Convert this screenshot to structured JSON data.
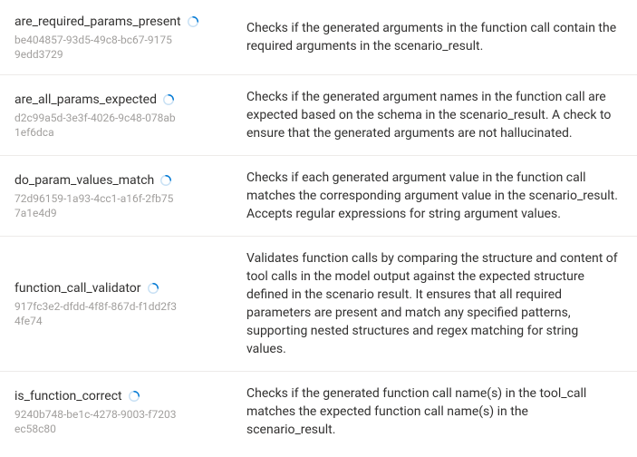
{
  "items": [
    {
      "name": "are_required_params_present",
      "uuid": "be404857-93d5-49c8-bc67-91759edd3729",
      "description": "Checks if the generated arguments in the function call contain the required arguments in the scenario_result."
    },
    {
      "name": "are_all_params_expected",
      "uuid": "d2c99a5d-3e3f-4026-9c48-078ab1ef6dca",
      "description": "Checks if the generated argument names in the function call are expected based on the schema in the scenario_result. A check to ensure that the generated arguments are not hallucinated."
    },
    {
      "name": "do_param_values_match",
      "uuid": "72d96159-1a93-4cc1-a16f-2fb757a1e4d9",
      "description": "Checks if each generated argument value in the function call matches the corresponding argument value in the scenario_result. Accepts regular expressions for string argument values."
    },
    {
      "name": "function_call_validator",
      "uuid": "917fc3e2-dfdd-4f8f-867d-f1dd2f34fe74",
      "description": "Validates function calls by comparing the structure and content of tool calls in the model output against the expected structure defined in the scenario result. It ensures that all required parameters are present and match any specified patterns, supporting nested structures and regex matching for string values."
    },
    {
      "name": "is_function_correct",
      "uuid": "9240b748-be1c-4278-9003-f7203ec58c80",
      "description": "Checks if the generated function call name(s) in the tool_call matches the expected function call name(s) in the scenario_result."
    }
  ]
}
